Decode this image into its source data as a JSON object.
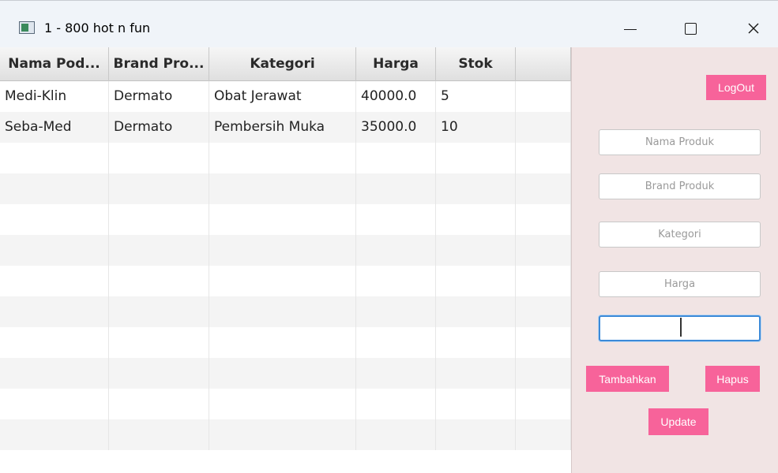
{
  "window": {
    "title": "1 - 800 hot n fun",
    "controls": {
      "minimize_icon": "minimize-icon",
      "maximize_icon": "maximize-icon",
      "close_icon": "close-icon"
    }
  },
  "table": {
    "columns": [
      "Nama Pod...",
      "Brand Pro...",
      "Kategori",
      "Harga",
      "Stok",
      ""
    ],
    "rows": [
      [
        "Medi-Klin",
        "Dermato",
        "Obat Jerawat",
        "40000.0",
        "5",
        ""
      ],
      [
        "Seba-Med",
        "Dermato",
        "Pembersih Muka",
        "35000.0",
        "10",
        ""
      ]
    ],
    "empty_rows": 10
  },
  "panel": {
    "logout_label": "LogOut",
    "fields": {
      "nama_produk": {
        "placeholder": "Nama Produk",
        "value": ""
      },
      "brand_produk": {
        "placeholder": "Brand Produk",
        "value": ""
      },
      "kategori": {
        "placeholder": "Kategori",
        "value": ""
      },
      "harga": {
        "placeholder": "Harga",
        "value": ""
      },
      "stok": {
        "placeholder": "",
        "value": ""
      }
    },
    "add_label": "Tambahkan",
    "delete_label": "Hapus",
    "update_label": "Update"
  },
  "colors": {
    "accent_button": "#f7639a",
    "panel_background": "#f1e4e4",
    "focus_border": "#3c8ad8"
  }
}
